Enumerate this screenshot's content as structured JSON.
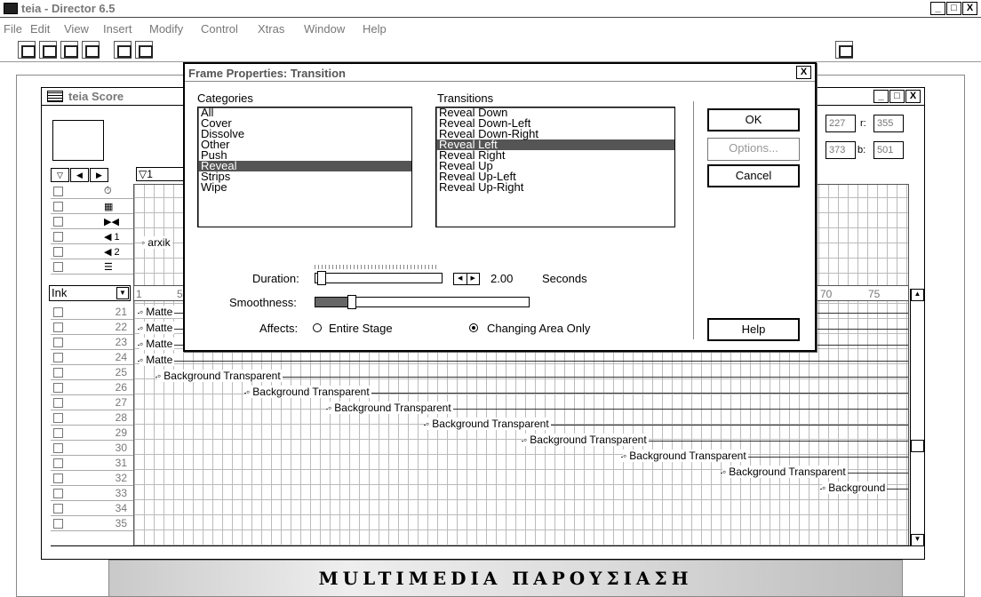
{
  "app": {
    "title": "teia - Director 6.5",
    "min": "_",
    "max": "□",
    "close": "X"
  },
  "menu": [
    "File",
    "Edit",
    "View",
    "Insert",
    "Modify",
    "Control",
    "Xtras",
    "Window",
    "Help"
  ],
  "score": {
    "title": "teia Score",
    "marker": "▽1",
    "ink": "Ink",
    "channels": [
      "21",
      "22",
      "23",
      "24",
      "25",
      "26",
      "27",
      "28",
      "29",
      "30",
      "31",
      "32",
      "33",
      "34",
      "35"
    ],
    "special_channels": [
      "tempo",
      "palette",
      "transition",
      "sound 1",
      "sound 2",
      "script"
    ],
    "sound1": "1",
    "sound2": "2",
    "frame_numbers": [
      "1",
      "5",
      "70",
      "75"
    ],
    "sprites": [
      "Matte",
      "Matte",
      "Matte",
      "Matte",
      "Background Transparent",
      "Background Transparent",
      "Background Transparent",
      "Background Transparent",
      "Background Transparent",
      "Background Transparent",
      "Background Transparent",
      "Background"
    ],
    "sound_sprite": "arxik",
    "coords": {
      "l": "227",
      "r_label": "r:",
      "r": "355",
      "t": "373",
      "b_label": "b:",
      "b": "501"
    }
  },
  "banner": "MULTIMEDIA ΠΑΡΟΥΣΙΑΣΗ",
  "dialog": {
    "title": "Frame Properties: Transition",
    "close": "X",
    "categories_label": "Categories",
    "categories": [
      "All",
      "Cover",
      "Dissolve",
      "Other",
      "Push",
      "Reveal",
      "Strips",
      "Wipe"
    ],
    "categories_selected": 5,
    "transitions_label": "Transitions",
    "transitions": [
      "Reveal Down",
      "Reveal Down-Left",
      "Reveal Down-Right",
      "Reveal Left",
      "Reveal Right",
      "Reveal Up",
      "Reveal Up-Left",
      "Reveal Up-Right"
    ],
    "transitions_selected": 3,
    "ok": "OK",
    "options": "Options...",
    "cancel": "Cancel",
    "help": "Help",
    "duration_label": "Duration:",
    "duration_value": "2.00",
    "duration_unit": "Seconds",
    "smoothness_label": "Smoothness:",
    "smoothness_level": 0.15,
    "affects_label": "Affects:",
    "affects_entire": "Entire Stage",
    "affects_changing": "Changing Area Only",
    "affects_selected": "Changing Area Only"
  }
}
